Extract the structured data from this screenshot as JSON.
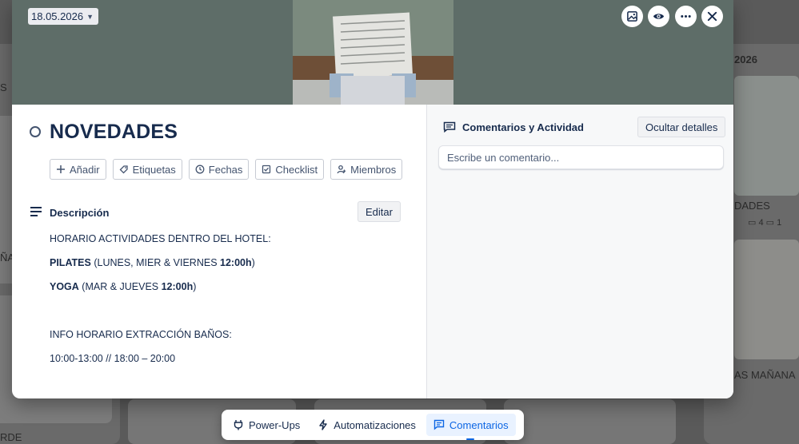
{
  "background": {
    "date_fragment": "2026",
    "card_left_fragment_1": "S",
    "card_left_fragment_2": "ÑA",
    "card_left_fragment_3": "RDE",
    "card_right_title_1": "DADES",
    "card_right_title_2": "AS MAÑANA",
    "card_right_badges": [
      "4",
      "1"
    ]
  },
  "modal": {
    "date_chip": "18.05.2026",
    "title": "NOVEDADES",
    "chips": [
      {
        "label": "Añadir",
        "icon": "plus-icon"
      },
      {
        "label": "Etiquetas",
        "icon": "tag-icon"
      },
      {
        "label": "Fechas",
        "icon": "clock-icon"
      },
      {
        "label": "Checklist",
        "icon": "checkbox-icon"
      },
      {
        "label": "Miembros",
        "icon": "person-icon"
      }
    ],
    "description": {
      "heading": "Descripción",
      "edit_label": "Editar",
      "line1": "HORARIO ACTIVIDADES DENTRO DEL HOTEL:",
      "pilates_bold": "PILATES",
      "pilates_text": " (LUNES, MIER & VIERNES ",
      "pilates_time": "12:00h",
      "close_paren": ")",
      "yoga_bold": "YOGA",
      "yoga_text": " (MAR & JUEVES ",
      "yoga_time": "12:00h",
      "line4": "INFO HORARIO EXTRACCIÓN BAÑOS:",
      "line5": "10:00-13:00 // 18:00 – 20:00"
    },
    "activity": {
      "heading": "Comentarios y Actividad",
      "hide_label": "Ocultar detalles",
      "comment_placeholder": "Escribe un comentario..."
    }
  },
  "bottom_bar": {
    "items": [
      {
        "label": "Power-Ups",
        "icon": "power-plug-icon",
        "active": false
      },
      {
        "label": "Automatizaciones",
        "icon": "lightning-icon",
        "active": false
      },
      {
        "label": "Comentarios",
        "icon": "comment-icon",
        "active": true
      }
    ]
  },
  "colors": {
    "accent": "#0c66e4",
    "cover": "#5e6d68",
    "text": "#172b4d"
  }
}
